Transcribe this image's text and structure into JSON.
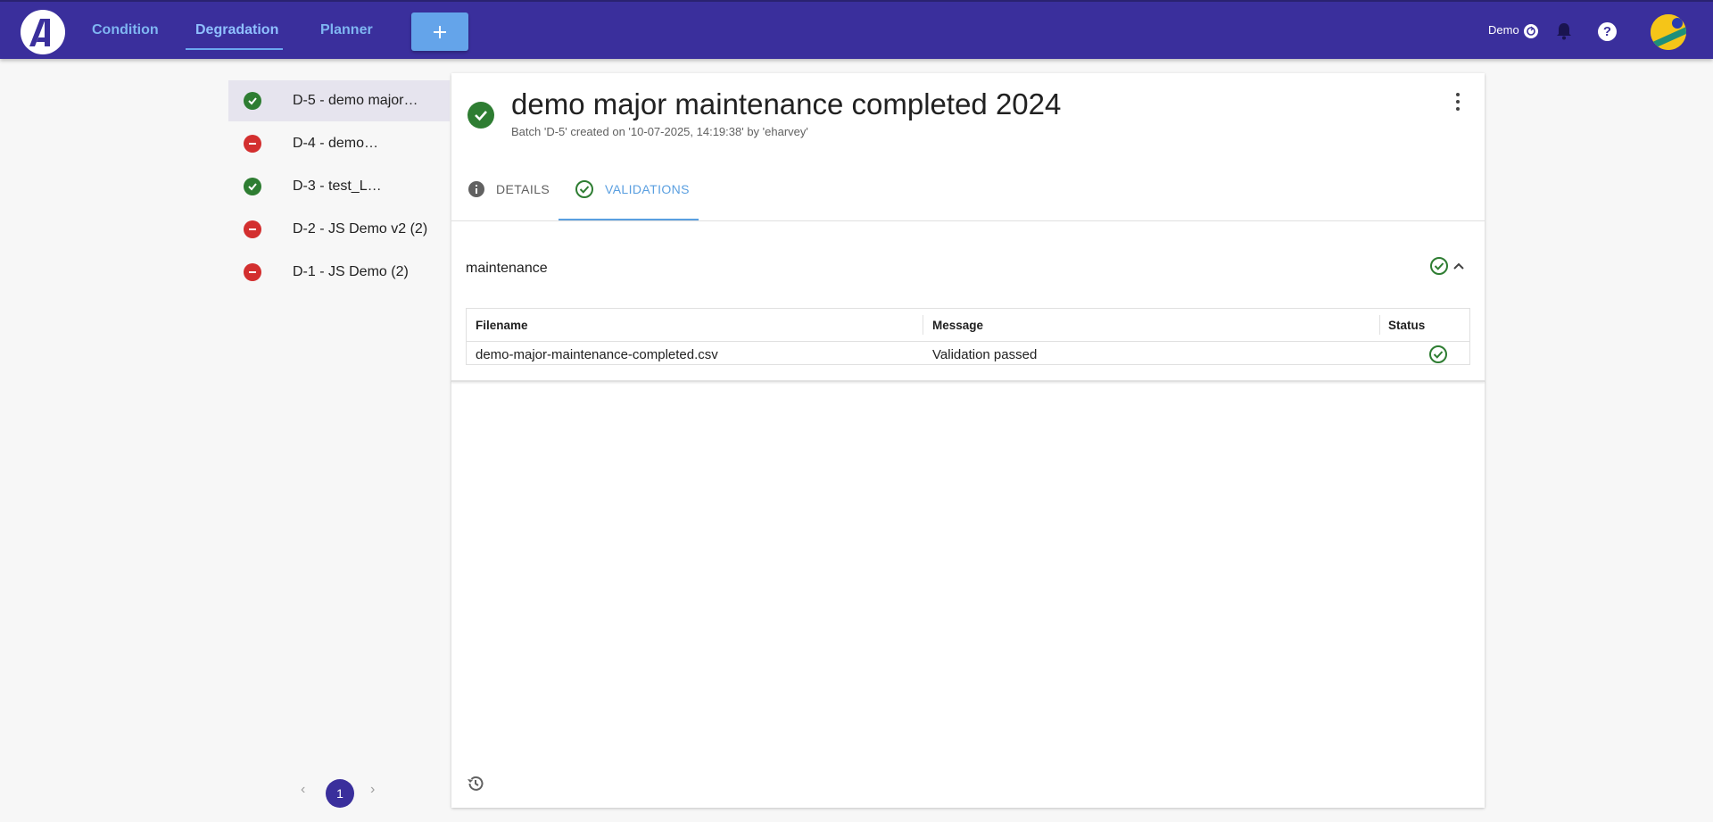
{
  "nav": {
    "tabs": [
      {
        "label": "Condition"
      },
      {
        "label": "Degradation"
      },
      {
        "label": "Planner"
      }
    ],
    "add_label": "+",
    "mode_label": "Demo",
    "help_label": "?",
    "accent": "#3a2f9c"
  },
  "sidebar": {
    "items": [
      {
        "label": "D-5 - demo major…",
        "status": "passed"
      },
      {
        "label": "D-4 - demo…",
        "status": "failed"
      },
      {
        "label": "D-3 - test_L…",
        "status": "passed"
      },
      {
        "label": "D-2 - JS Demo v2 (2)",
        "status": "failed"
      },
      {
        "label": "D-1 - JS Demo (2)",
        "status": "failed"
      }
    ],
    "pagination": {
      "prev": "‹",
      "page": "1",
      "next": "›"
    }
  },
  "batch": {
    "title": "demo major maintenance completed 2024",
    "subtitle": "Batch 'D-5' created on '10-07-2025, 14:19:38' by 'eharvey'",
    "tabs": [
      {
        "label": "DETAILS",
        "icon": "info-icon"
      },
      {
        "label": "VALIDATIONS",
        "icon": "check-circle-icon"
      }
    ],
    "active_tab": "VALIDATIONS"
  },
  "validations": {
    "section": "maintenance",
    "columns": [
      "Filename",
      "Message",
      "Status"
    ],
    "rows": [
      {
        "filename": "demo-major-maintenance-completed.csv",
        "message": "Validation passed",
        "status": "passed"
      }
    ]
  },
  "colors": {
    "ok": "#2e7d32",
    "error": "#d32f2f",
    "link": "#5a9fe0"
  }
}
